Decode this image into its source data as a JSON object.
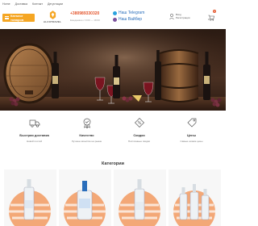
{
  "topnav": {
    "items": [
      "Home",
      "Доставка",
      "Контакт",
      "Дегустации"
    ]
  },
  "header": {
    "catalog_label": "Каталог товаров",
    "logo_text": "ALCOTRAVEL",
    "phone": "+380989330320",
    "phone_sub": "Ежедневно с 9:00 — 18:00",
    "messengers": [
      {
        "label": "Наш Telegram",
        "color": "#2aa3df"
      },
      {
        "label": "Наш Вайбер",
        "color": "#7b519d"
      }
    ],
    "account_lines": [
      "Вход",
      "Регистрация"
    ],
    "cart_count": "0",
    "cart_price": "0 грн"
  },
  "features": [
    {
      "title": "Быстрая доставка",
      "sub": "Новой почтой",
      "icon": "truck-icon"
    },
    {
      "title": "Качество",
      "sub": "Лучшее качество на рынке",
      "icon": "quality-badge-icon"
    },
    {
      "title": "Скидки",
      "sub": "Постоянные скидки",
      "icon": "discount-tag-icon"
    },
    {
      "title": "Цены",
      "sub": "Самые низкие цены",
      "icon": "price-tag-icon"
    }
  ],
  "categories_title": "Категории",
  "colors": {
    "accent": "#f5a623",
    "phone": "#e4572e",
    "link": "#2a6ebb",
    "card_stripe": "#f3a877"
  }
}
